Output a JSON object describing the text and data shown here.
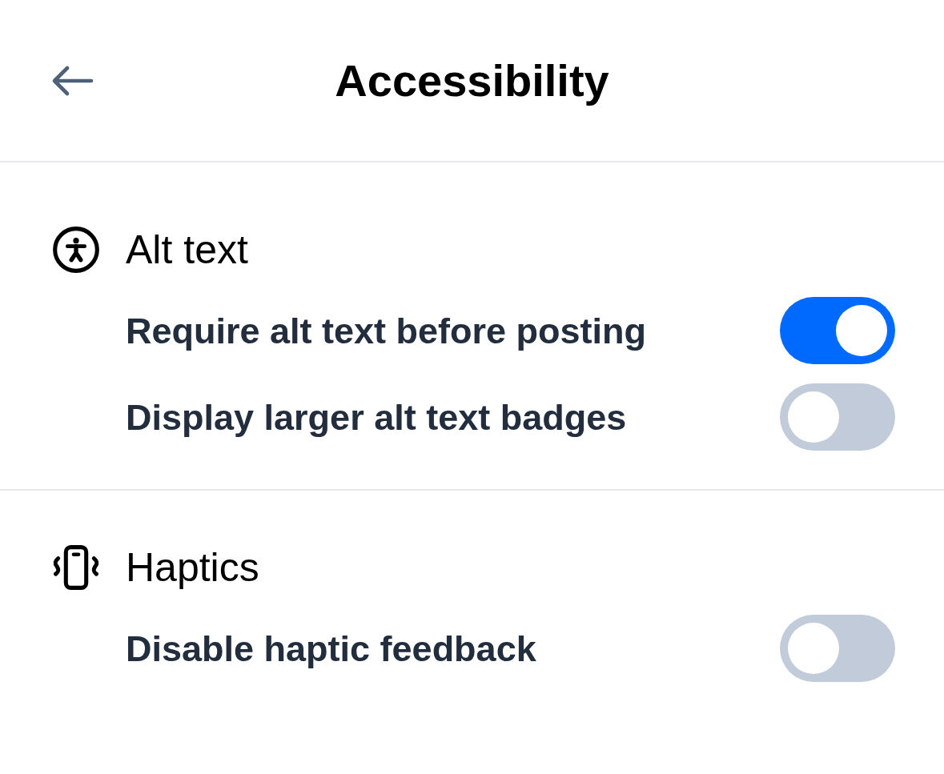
{
  "header": {
    "title": "Accessibility"
  },
  "sections": [
    {
      "title": "Alt text",
      "settings": [
        {
          "label": "Require alt text before posting",
          "on": true
        },
        {
          "label": "Display larger alt text badges",
          "on": false
        }
      ]
    },
    {
      "title": "Haptics",
      "settings": [
        {
          "label": "Disable haptic feedback",
          "on": false
        }
      ]
    }
  ]
}
